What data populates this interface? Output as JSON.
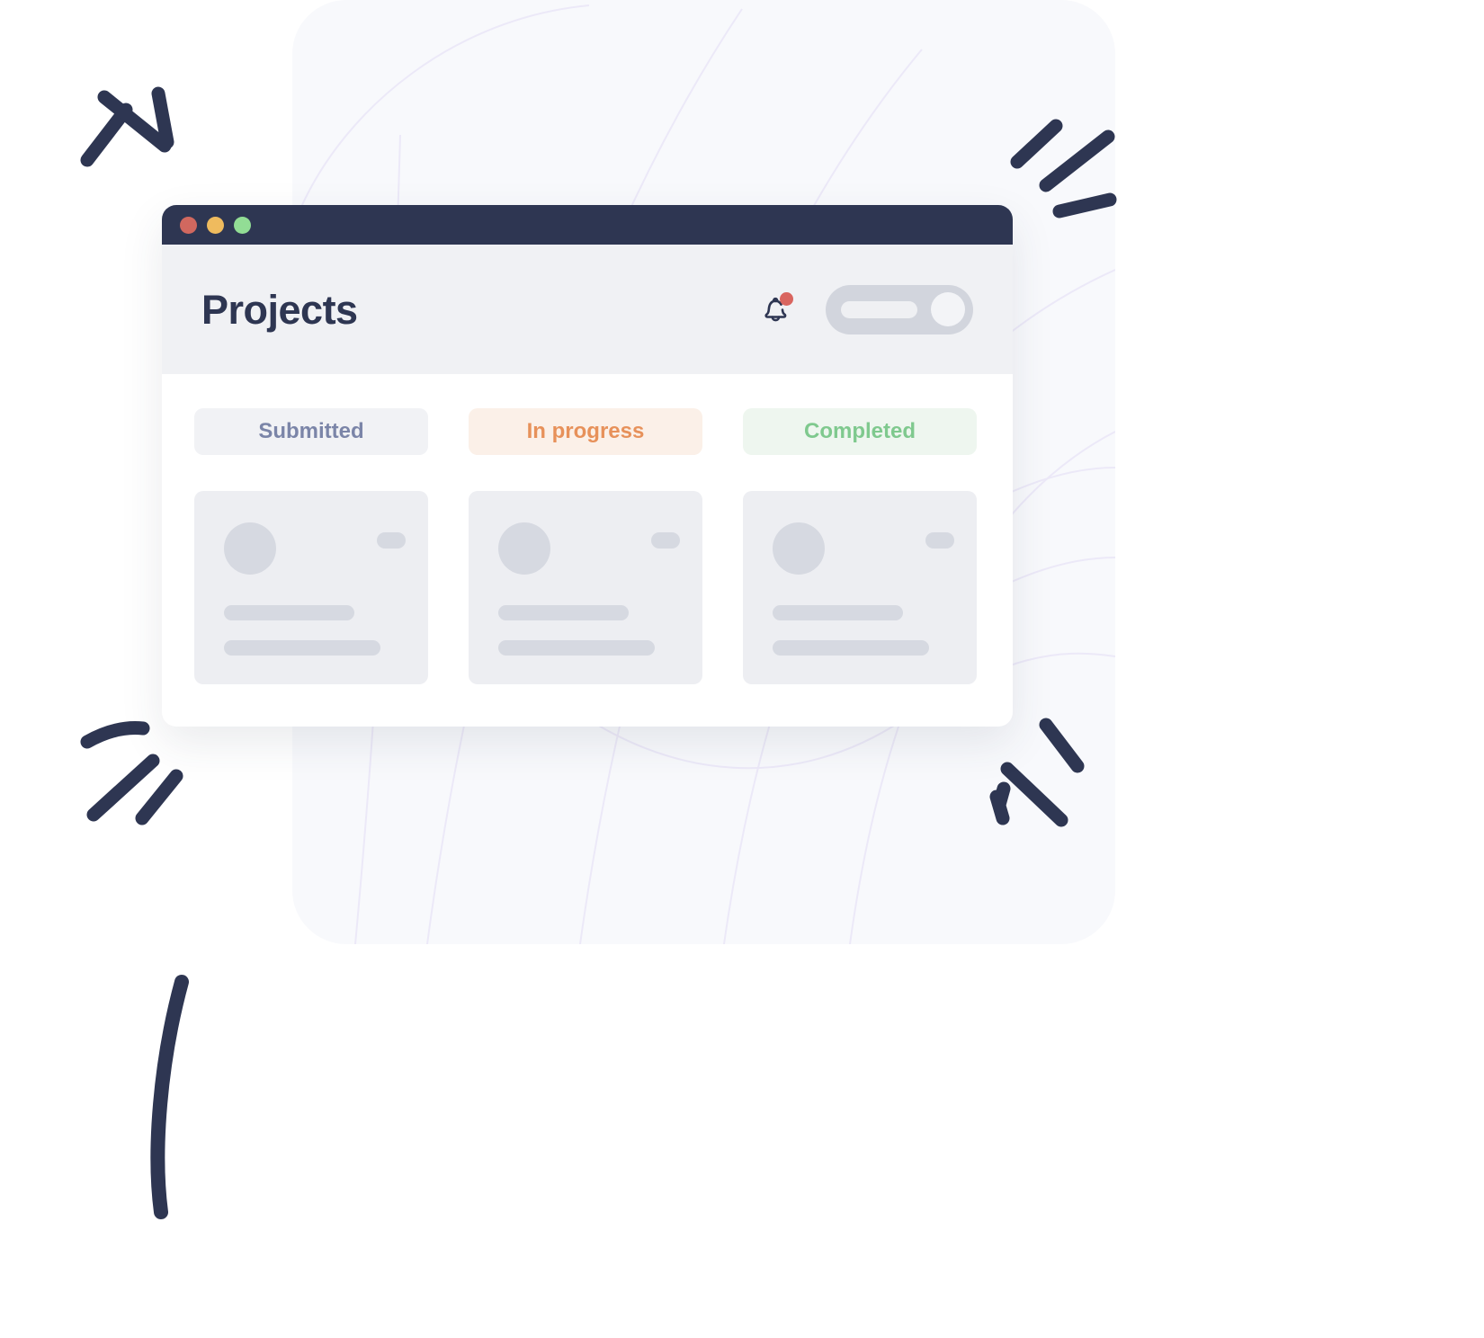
{
  "window": {
    "title": "Projects",
    "traffic_lights": [
      {
        "name": "close",
        "color": "#d1685f"
      },
      {
        "name": "minimize",
        "color": "#efbb5e"
      },
      {
        "name": "maximize",
        "color": "#92dd95"
      }
    ],
    "titlebar_color": "#2e3652",
    "header_bg": "#f0f1f4"
  },
  "header": {
    "notification": {
      "icon": "bell-icon",
      "has_unread_badge": true,
      "badge_color": "#d9655f"
    },
    "toggle": {
      "icon": "toggle-switch",
      "state": "on",
      "track_color": "#d2d5dd",
      "knob_color": "#f3f4f7"
    }
  },
  "tabs": [
    {
      "label": "Submitted",
      "bg": "#f1f2f5",
      "text_color": "#7b85a8"
    },
    {
      "label": "In progress",
      "bg": "#fbf0e8",
      "text_color": "#e7915a"
    },
    {
      "label": "Completed",
      "bg": "#eef6ef",
      "text_color": "#7fc98e"
    }
  ],
  "cards": [
    {
      "status": "Submitted",
      "placeholder": true
    },
    {
      "status": "In progress",
      "placeholder": true
    },
    {
      "status": "Completed",
      "placeholder": true
    }
  ],
  "decor": {
    "sparkle_color": "#2e3652",
    "background_panel_color": "#f8f9fc",
    "contour_line_color": "#ece9f8"
  }
}
